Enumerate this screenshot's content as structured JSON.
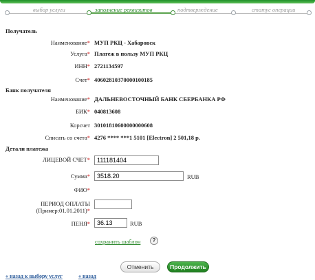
{
  "steps": [
    "выбор услуги",
    "заполнение реквизитов",
    "подтверждение",
    "статус операции"
  ],
  "recipient": {
    "heading": "Получатель",
    "name_label": "Наименование",
    "name_value": "МУП РКЦ - Хабаровск",
    "service_label": "Услуга",
    "service_value": "Платеж в пользу МУП РКЦ",
    "inn_label": "ИНН",
    "inn_value": "2721134597",
    "account_label": "Счет",
    "account_value": "40602810370000100185"
  },
  "bank": {
    "heading": "Банк получателя",
    "name_label": "Наименование",
    "name_value": "ДАЛЬНЕВОСТОЧНЫЙ БАНК СБЕРБАНКА РФ",
    "bik_label": "БИК",
    "bik_value": "040813608",
    "corr_label": "Корсчет",
    "corr_value": "30101810600000000608",
    "debit_label": "Списать со счета",
    "debit_value": "4276 **** ***1 5101  [Electron] 2 501,18  р."
  },
  "details": {
    "heading": "Детали платежа",
    "account_label": "ЛИЦЕВОЙ СЧЕТ",
    "account_value": "111181404",
    "sum_label": "Сумма",
    "sum_value": "3518.20",
    "sum_unit": "RUB",
    "fio_label": "ФИО",
    "period_label_line1": "ПЕРИОД ОПЛАТЫ",
    "period_label_line2": "(Пример:01.01.2011)",
    "period_value": "",
    "penalty_label": "ПЕНЯ",
    "penalty_value": "36.13",
    "penalty_unit": "RUB"
  },
  "actions": {
    "save_template": "сохранить шаблон",
    "help": "?",
    "cancel": "Отменить",
    "continue": "Продолжить",
    "back_services": "« назад к выбору услуг",
    "back": "« назад"
  },
  "required_mark": "*",
  "colors": {
    "accent": "#2e8a2e",
    "required": "#d01919",
    "link_blue": "#2a5a9a"
  }
}
